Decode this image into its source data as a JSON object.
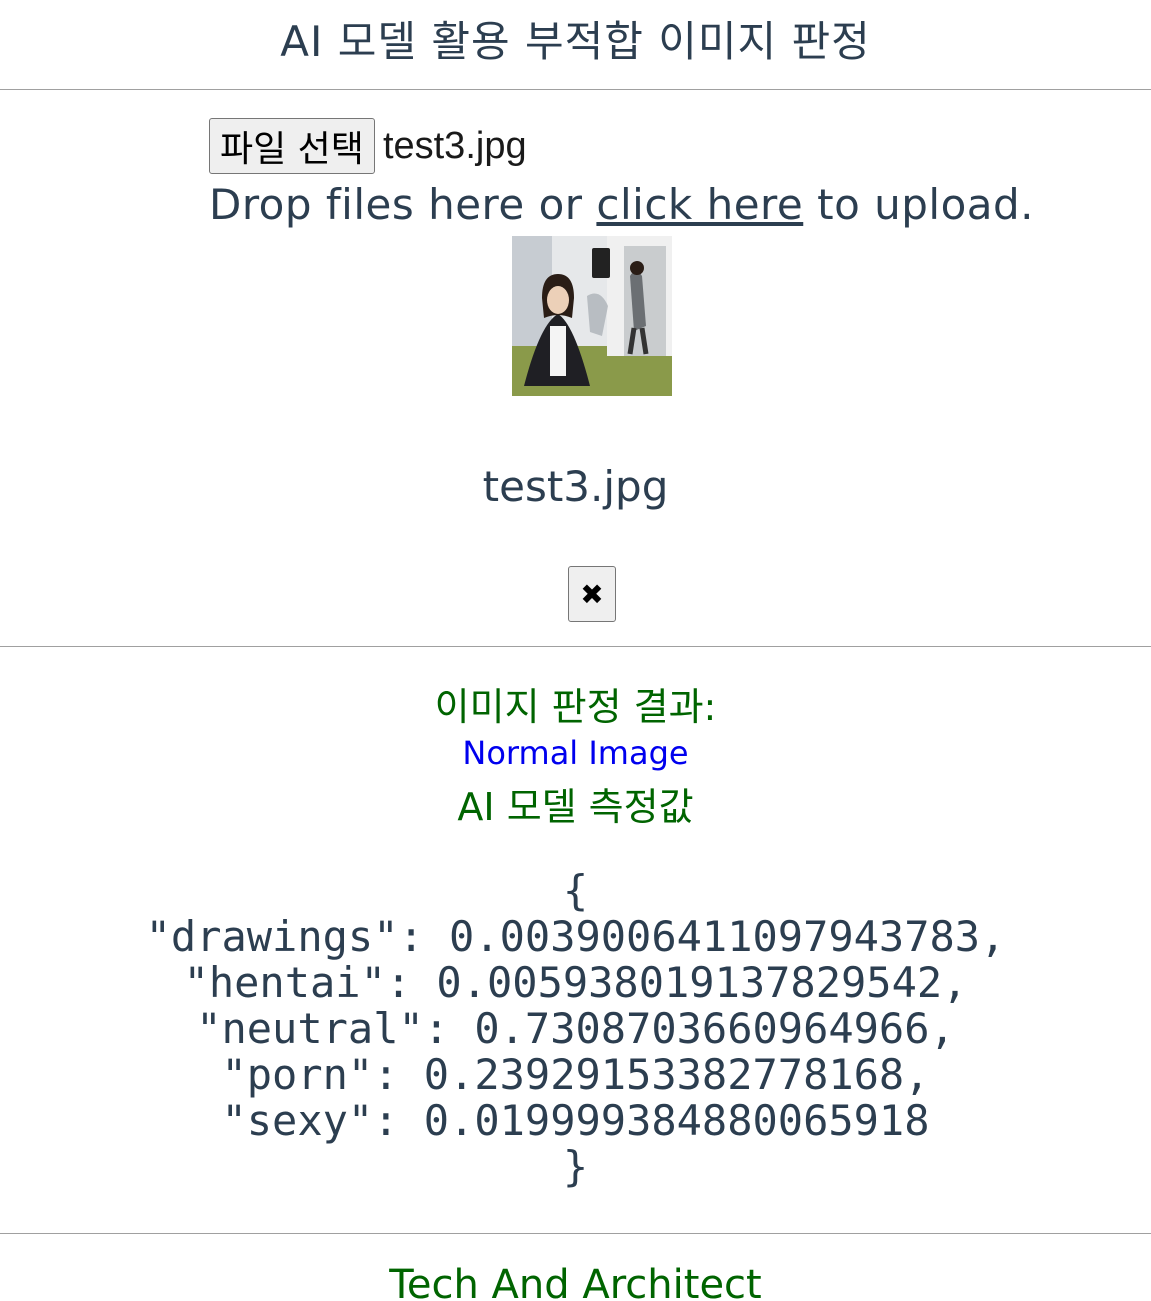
{
  "header": {
    "title": "AI 모델 활용 부적합 이미지 판정"
  },
  "upload": {
    "choose_button_label": "파일 선택",
    "selected_file_name": "test3.jpg",
    "drop_text_before": "Drop files here or ",
    "drop_link_text": "click here",
    "drop_text_after": " to upload."
  },
  "preview": {
    "file_name": "test3.jpg",
    "remove_button_label": "✖"
  },
  "result": {
    "title": "이미지 판정 결과:",
    "value": "Normal Image",
    "metric_title": "AI 모델 측정값",
    "json_open": "{",
    "lines": [
      "\"drawings\": 0.0039006411097943783,",
      "\"hentai\": 0.005938019137829542,",
      "\"neutral\": 0.7308703660964966,",
      "\"porn\": 0.23929153382778168,",
      "\"sexy\": 0.019999384880065918"
    ],
    "json_close": "}"
  },
  "footer": {
    "text": "Tech And Architect"
  },
  "colors": {
    "text_primary": "#2c3e50",
    "result_green": "#006400",
    "result_blue": "#0000ee"
  }
}
